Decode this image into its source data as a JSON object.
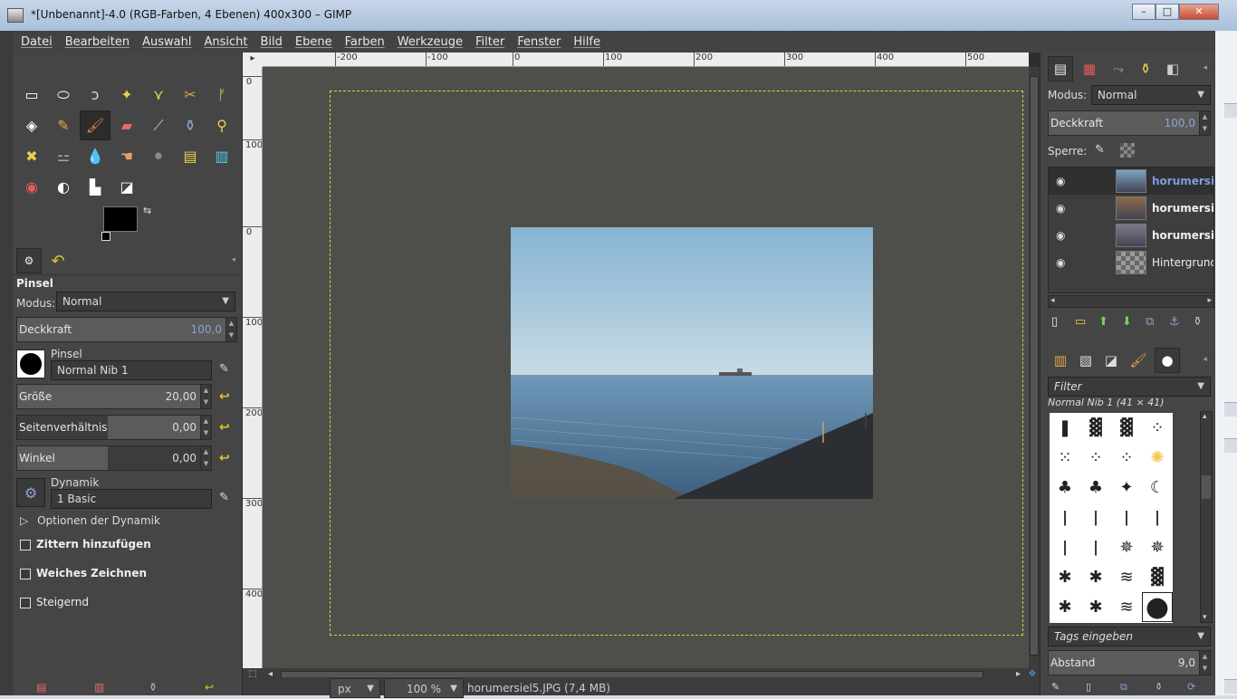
{
  "window": {
    "title": "*[Unbenannt]-4.0 (RGB-Farben, 4 Ebenen) 400x300 – GIMP",
    "controls": [
      "–",
      "□",
      "✕"
    ]
  },
  "menubar": {
    "items": [
      "Datei",
      "Bearbeiten",
      "Auswahl",
      "Ansicht",
      "Bild",
      "Ebene",
      "Farben",
      "Werkzeuge",
      "Filter",
      "Fenster",
      "Hilfe"
    ]
  },
  "toolbox": {
    "tools": [
      {
        "name": "rect-select-icon",
        "glyph": "▭",
        "color": "#ffffff"
      },
      {
        "name": "ellipse-select-icon",
        "glyph": "⬭",
        "color": "#ffffff"
      },
      {
        "name": "free-select-icon",
        "glyph": "ↄ",
        "color": "#d8d8d8"
      },
      {
        "name": "fuzzy-select-icon",
        "glyph": "✦",
        "color": "#e9d24b"
      },
      {
        "name": "color-select-icon",
        "glyph": "⋎",
        "color": "#e9d24b"
      },
      {
        "name": "scissors-icon",
        "glyph": "✂",
        "color": "#d9a64b"
      },
      {
        "name": "foreground-select-icon",
        "glyph": "ᚠ",
        "color": "#e9d24b"
      },
      {
        "name": "paint-bucket-icon",
        "glyph": "◈",
        "color": "#ffffff"
      },
      {
        "name": "pencil-icon",
        "glyph": "✎",
        "color": "#e9a64b"
      },
      {
        "name": "paintbrush-icon",
        "glyph": "🖌",
        "color": "#e8884b"
      },
      {
        "name": "eraser-icon",
        "glyph": "▰",
        "color": "#e86a6a"
      },
      {
        "name": "airbrush-icon",
        "glyph": "⟋",
        "color": "#cccccc"
      },
      {
        "name": "ink-icon",
        "glyph": "⚱",
        "color": "#8aa5d0"
      },
      {
        "name": "clone-icon",
        "glyph": "⚲",
        "color": "#e9d24b"
      },
      {
        "name": "heal-icon",
        "glyph": "✖",
        "color": "#e9d24b"
      },
      {
        "name": "perspective-clone-icon",
        "glyph": "⚍",
        "color": "#8aa5d0"
      },
      {
        "name": "blur-icon",
        "glyph": "💧",
        "color": "#8aa5d0"
      },
      {
        "name": "smudge-icon",
        "glyph": "☚",
        "color": "#e8a06a"
      },
      {
        "name": "dodge-burn-icon",
        "glyph": "⚫",
        "color": "#888888"
      },
      {
        "name": "levels-icon",
        "glyph": "▤",
        "color": "#e9d24b"
      },
      {
        "name": "curves-icon",
        "glyph": "▥",
        "color": "#4bd0e8"
      },
      {
        "name": "color-balance-icon",
        "glyph": "◉",
        "color": "#e85a5a"
      },
      {
        "name": "brightness-icon",
        "glyph": "◐",
        "color": "#ffffff"
      },
      {
        "name": "histogram-icon",
        "glyph": "▙",
        "color": "#ffffff"
      },
      {
        "name": "threshold-icon",
        "glyph": "◪",
        "color": "#ffffff"
      }
    ],
    "active_tool_index": 9,
    "fg_color": "#000000",
    "bg_color": "#ffffff"
  },
  "tool_options": {
    "title": "Pinsel",
    "mode_label": "Modus:",
    "mode_value": "Normal",
    "opacity_label": "Deckkraft",
    "opacity_value": "100,0",
    "brush_label": "Pinsel",
    "brush_value": "Normal Nib 1",
    "size_label": "Größe",
    "size_value": "20,00",
    "aspect_label": "Seitenverhältnis",
    "aspect_value": "0,00",
    "angle_label": "Winkel",
    "angle_value": "0,00",
    "dynamics_label": "Dynamik",
    "dynamics_value": "1 Basic",
    "dynamics_options": "Optionen der Dynamik",
    "jitter_label": "Zittern hinzufügen",
    "smooth_label": "Weiches Zeichnen",
    "incremental_label": "Steigernd"
  },
  "image_window": {
    "ruler_top": [
      "-200",
      "-100",
      "0",
      "100",
      "200",
      "300",
      "400",
      "500"
    ],
    "ruler_left": [
      "0",
      "100",
      "0",
      "100",
      "200",
      "300",
      "400"
    ],
    "unit": "px",
    "zoom": "100 %",
    "status_file": "horumersiel5.JPG (7,4 MB)"
  },
  "layers_dock": {
    "mode_label": "Modus:",
    "mode_value": "Normal",
    "opacity_label": "Deckkraft",
    "opacity_value": "100,0",
    "lock_label": "Sperre:",
    "layers": [
      {
        "name": "horumersie",
        "thumb": "#7da4c4",
        "active": true,
        "bold": true
      },
      {
        "name": "horumersie",
        "thumb": "#8a6a4a",
        "active": false,
        "bold": true
      },
      {
        "name": "horumersie",
        "thumb": "#7a7a8a",
        "active": false,
        "bold": true
      },
      {
        "name": "Hintergrund",
        "thumb": "checker",
        "active": false,
        "bold": false
      }
    ]
  },
  "brushes_dock": {
    "filter_placeholder": "Filter",
    "brush_info": "Normal Nib 1 (41 × 41)",
    "tags_placeholder": "Tags eingeben",
    "spacing_label": "Abstand",
    "spacing_value": "9,0"
  }
}
